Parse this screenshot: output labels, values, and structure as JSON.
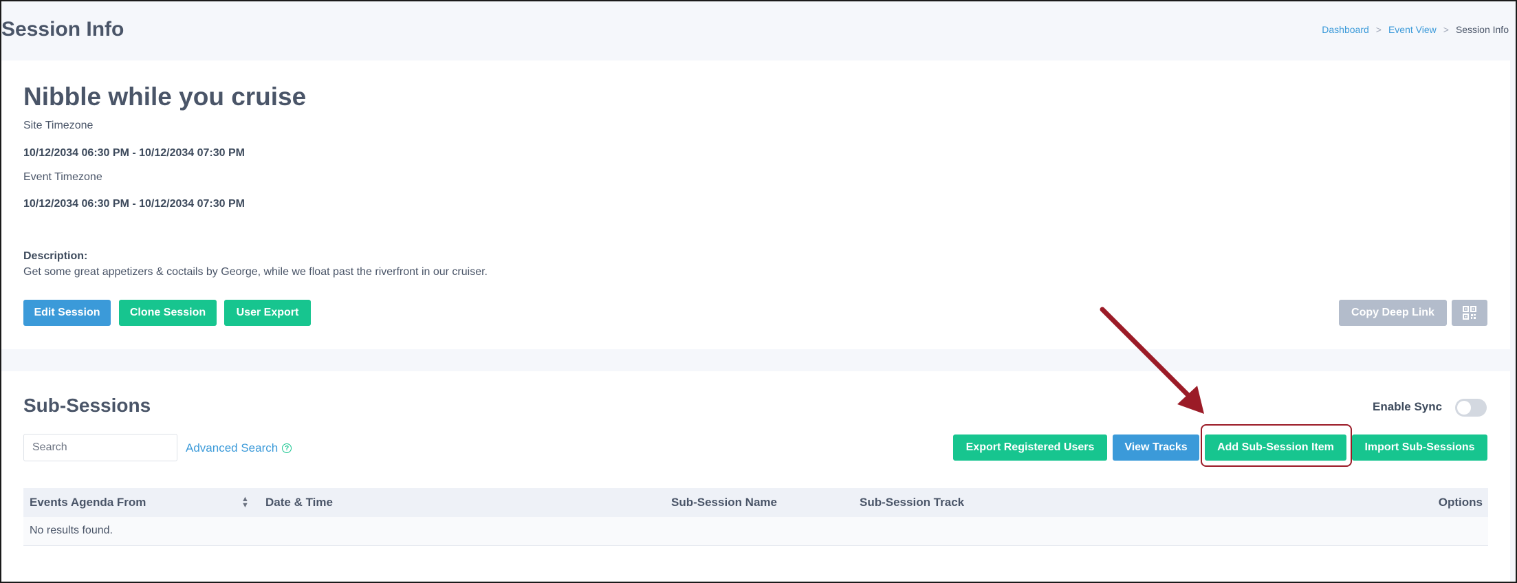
{
  "header": {
    "title": "Session Info",
    "breadcrumb": [
      {
        "label": "Dashboard"
      },
      {
        "label": "Event View"
      },
      {
        "label": "Session Info"
      }
    ],
    "separator": ">"
  },
  "session": {
    "title": "Nibble while you cruise",
    "site_tz_label": "Site Timezone",
    "site_tz_range": "10/12/2034 06:30 PM - 10/12/2034 07:30 PM",
    "event_tz_label": "Event Timezone",
    "event_tz_range": "10/12/2034 06:30 PM - 10/12/2034 07:30 PM",
    "description_label": "Description:",
    "description": "Get some great appetizers & coctails by George, while we float past the riverfront in our cruiser.",
    "buttons": {
      "edit": "Edit Session",
      "clone": "Clone Session",
      "user_export": "User Export",
      "copy_deep_link": "Copy Deep Link"
    }
  },
  "sub_sessions": {
    "title": "Sub-Sessions",
    "enable_sync_label": "Enable Sync",
    "search_placeholder": "Search",
    "advanced_search": "Advanced Search",
    "buttons": {
      "export_registered": "Export Registered Users",
      "view_tracks": "View Tracks",
      "add_item": "Add Sub-Session Item",
      "import": "Import Sub-Sessions"
    },
    "table": {
      "columns": [
        "Events Agenda From",
        "Date & Time",
        "Sub-Session Name",
        "Sub-Session Track",
        "Options"
      ],
      "empty": "No results found."
    }
  },
  "colors": {
    "primary_blue": "#3b9ad9",
    "primary_green": "#17c58f",
    "disabled_grey": "#b3bccb",
    "annotation_red": "#9b1b27"
  }
}
